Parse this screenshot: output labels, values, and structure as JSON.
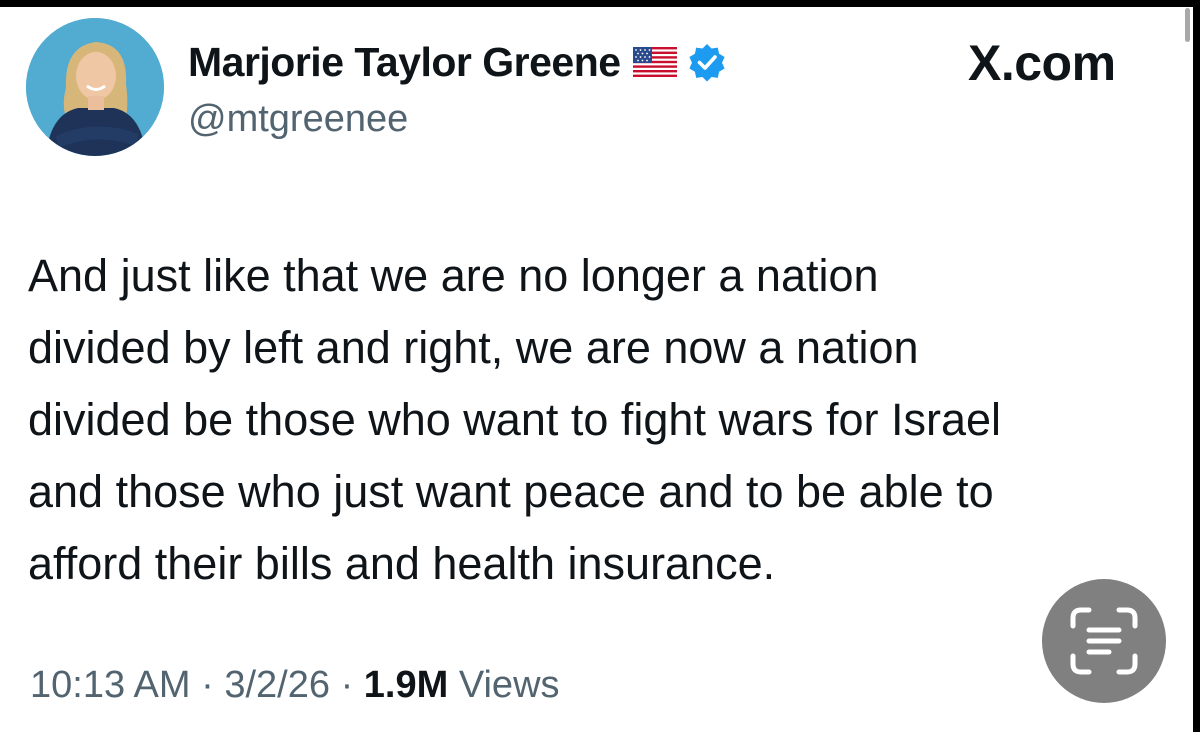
{
  "author": {
    "display_name": "Marjorie Taylor Greene",
    "handle": "@mtgreenee",
    "flag_icon": "us-flag-icon",
    "verified_icon": "verified-badge-icon",
    "verified_color": "#1d9bf0"
  },
  "brand": {
    "label": "X.com"
  },
  "tweet": {
    "lines": [
      "And just like that we are no longer a nation",
      "divided by left and right, we are now a nation",
      "divided be those who want to fight wars for Israel",
      "and those who just want peace and to be able to",
      "afford their bills and health insurance."
    ]
  },
  "meta": {
    "time": "10:13 AM",
    "separator": "·",
    "date": "3/2/26",
    "views_count": "1.9M",
    "views_label": "Views"
  },
  "scan_button": {
    "icon": "scan-text-icon"
  }
}
